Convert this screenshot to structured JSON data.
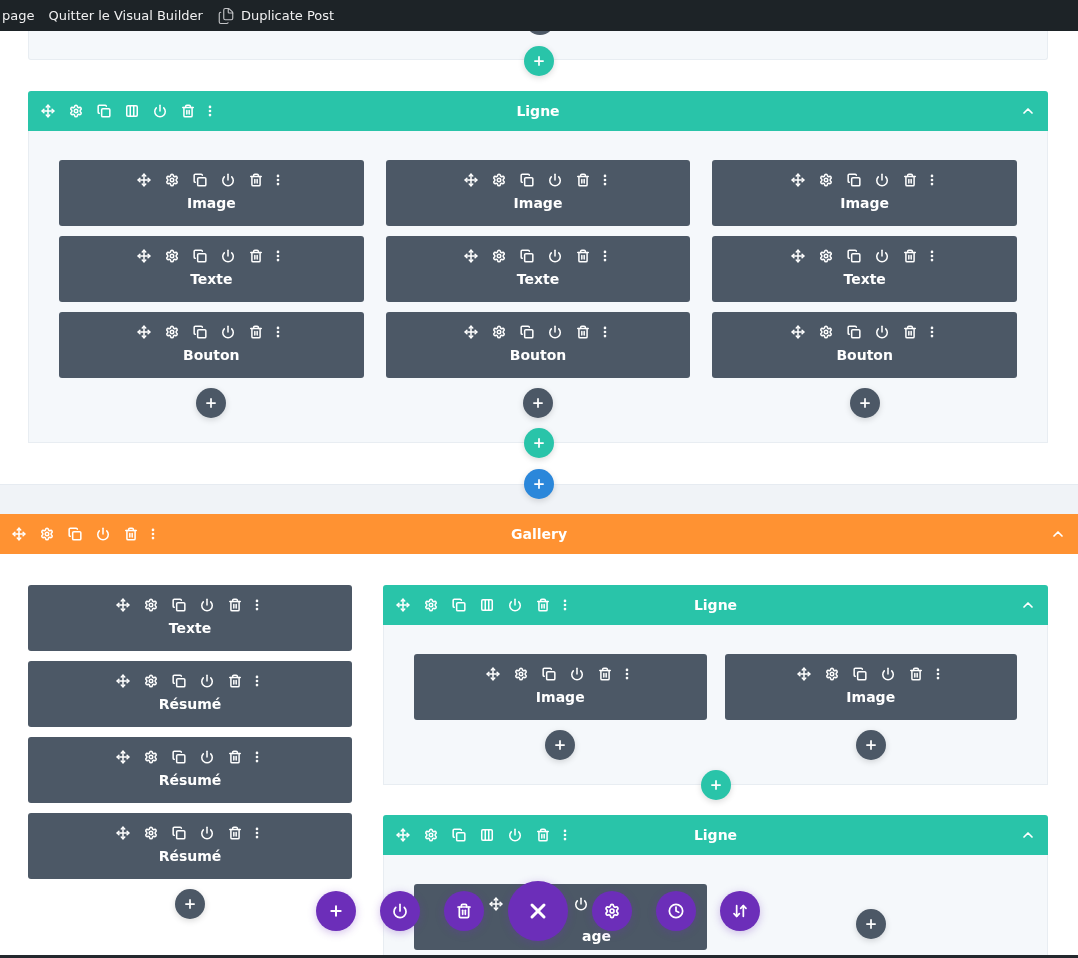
{
  "top_bar": {
    "items": [
      {
        "label": "page",
        "kind": "link"
      },
      {
        "label": "Quitter le Visual Builder",
        "kind": "link"
      },
      {
        "label": "Duplicate Post",
        "kind": "icon_link"
      }
    ]
  },
  "first_section": {
    "row": {
      "title": "Ligne",
      "columns": [
        {
          "modules": [
            {
              "label": "Image",
              "covered": false
            },
            {
              "label": "Texte",
              "covered": false
            },
            {
              "label": "Bouton",
              "covered": false
            }
          ]
        },
        {
          "modules": [
            {
              "label": "Image",
              "covered": false
            },
            {
              "label": "Texte",
              "covered": false
            },
            {
              "label": "Bouton",
              "covered": false
            }
          ]
        },
        {
          "modules": [
            {
              "label": "Image",
              "covered": false
            },
            {
              "label": "Texte",
              "covered": false
            },
            {
              "label": "Bouton",
              "covered": false
            }
          ]
        }
      ]
    }
  },
  "gallery": {
    "title": "Gallery",
    "column": {
      "modules": [
        {
          "label": "Texte",
          "covered": false
        },
        {
          "label": "Résumé",
          "covered": false
        },
        {
          "label": "Résumé",
          "covered": false
        },
        {
          "label": "Résumé",
          "covered": false
        }
      ]
    },
    "rows": [
      {
        "title": "Ligne",
        "columns": [
          {
            "modules": [
              {
                "label": "Image",
                "covered": false
              }
            ]
          },
          {
            "modules": [
              {
                "label": "Image",
                "covered": false
              }
            ]
          }
        ]
      },
      {
        "title": "Ligne",
        "columns": [
          {
            "modules": [
              {
                "label": "age",
                "covered": true
              }
            ]
          },
          {}
        ]
      }
    ]
  }
}
